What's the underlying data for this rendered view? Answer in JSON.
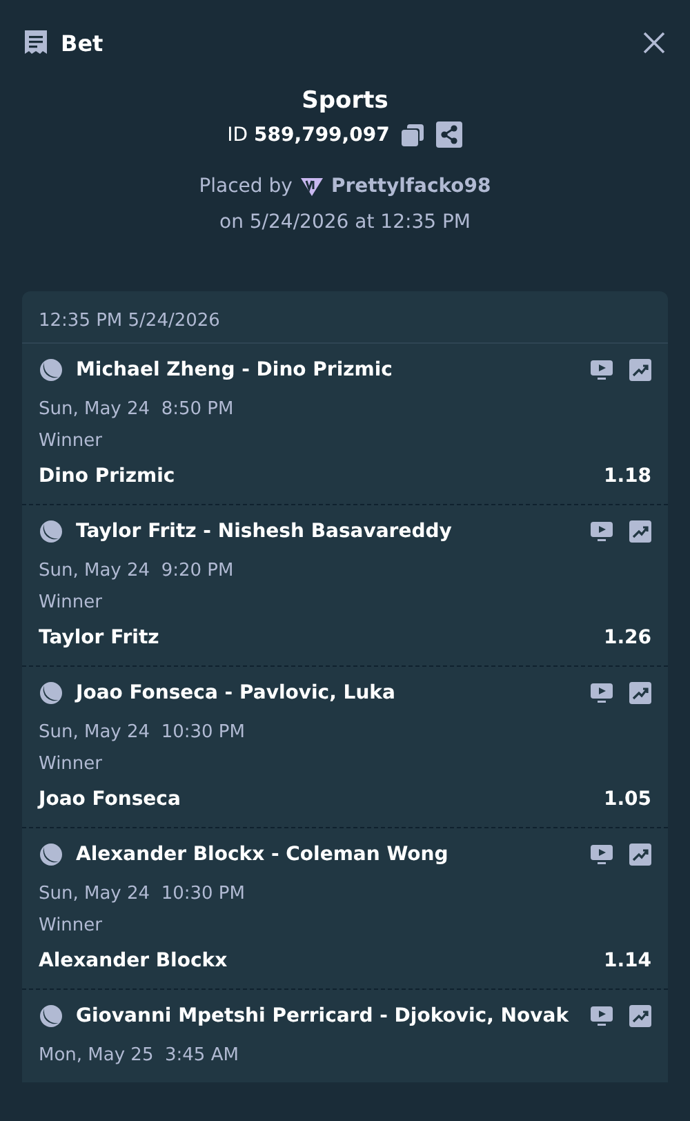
{
  "header": {
    "title": "Bet"
  },
  "summary": {
    "category": "Sports",
    "id_label": "ID",
    "id_value": "589,799,097",
    "placed_by_label": "Placed by",
    "user": "Prettylfacko98",
    "placed_on": "on 5/24/2026 at 12:35 PM"
  },
  "card": {
    "timestamp": "12:35 PM 5/24/2026",
    "legs": [
      {
        "match": "Michael Zheng - Dino Prizmic",
        "date": "Sun, May 24",
        "time": "8:50 PM",
        "market": "Winner",
        "pick": "Dino Prizmic",
        "odds": "1.18"
      },
      {
        "match": "Taylor Fritz - Nishesh Basavareddy",
        "date": "Sun, May 24",
        "time": "9:20 PM",
        "market": "Winner",
        "pick": "Taylor Fritz",
        "odds": "1.26"
      },
      {
        "match": "Joao Fonseca - Pavlovic, Luka",
        "date": "Sun, May 24",
        "time": "10:30 PM",
        "market": "Winner",
        "pick": "Joao Fonseca",
        "odds": "1.05"
      },
      {
        "match": "Alexander Blockx - Coleman Wong",
        "date": "Sun, May 24",
        "time": "10:30 PM",
        "market": "Winner",
        "pick": "Alexander Blockx",
        "odds": "1.14"
      },
      {
        "match": "Giovanni Mpetshi Perricard - Djokovic, Novak",
        "date": "Mon, May 25",
        "time": "3:45 AM"
      }
    ]
  }
}
